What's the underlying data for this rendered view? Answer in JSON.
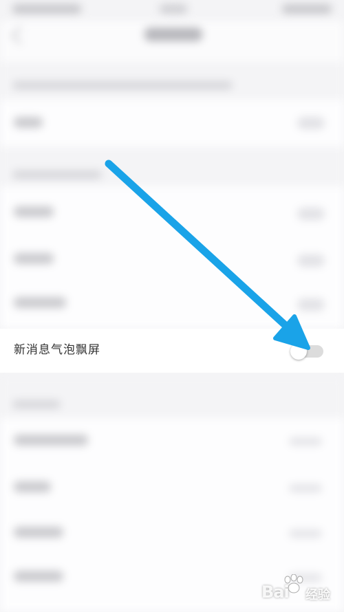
{
  "featured_setting": {
    "label": "新消息气泡飘屏",
    "toggle_on": false
  },
  "colors": {
    "arrow": "#1aa3e8",
    "toggle_off_track": "#dcdcdc",
    "label_text": "#333333"
  },
  "watermark": {
    "brand": "Bai",
    "suffix": "经验"
  },
  "icons": [
    "back-arrow-icon",
    "paw-icon"
  ]
}
